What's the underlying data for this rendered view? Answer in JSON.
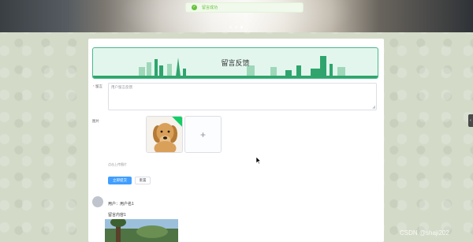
{
  "toast": {
    "icon": "check-circle-icon",
    "text": "留言成功"
  },
  "carousel": {
    "dots": 3,
    "active_index": 2
  },
  "side_tab": {
    "icon": "chevron-left-icon"
  },
  "header": {
    "title": "留言反馈"
  },
  "form": {
    "message_label": "留言",
    "message_required": "*",
    "message_placeholder": "用户留言反馈",
    "image_label": "图片",
    "upload_hint": "点击上传图片",
    "submit_label": "立即提交",
    "reset_label": "重置"
  },
  "comments": [
    {
      "user": "用户：用户名1",
      "content": "留言内容1"
    }
  ],
  "watermark": "CSDN @shaji202"
}
